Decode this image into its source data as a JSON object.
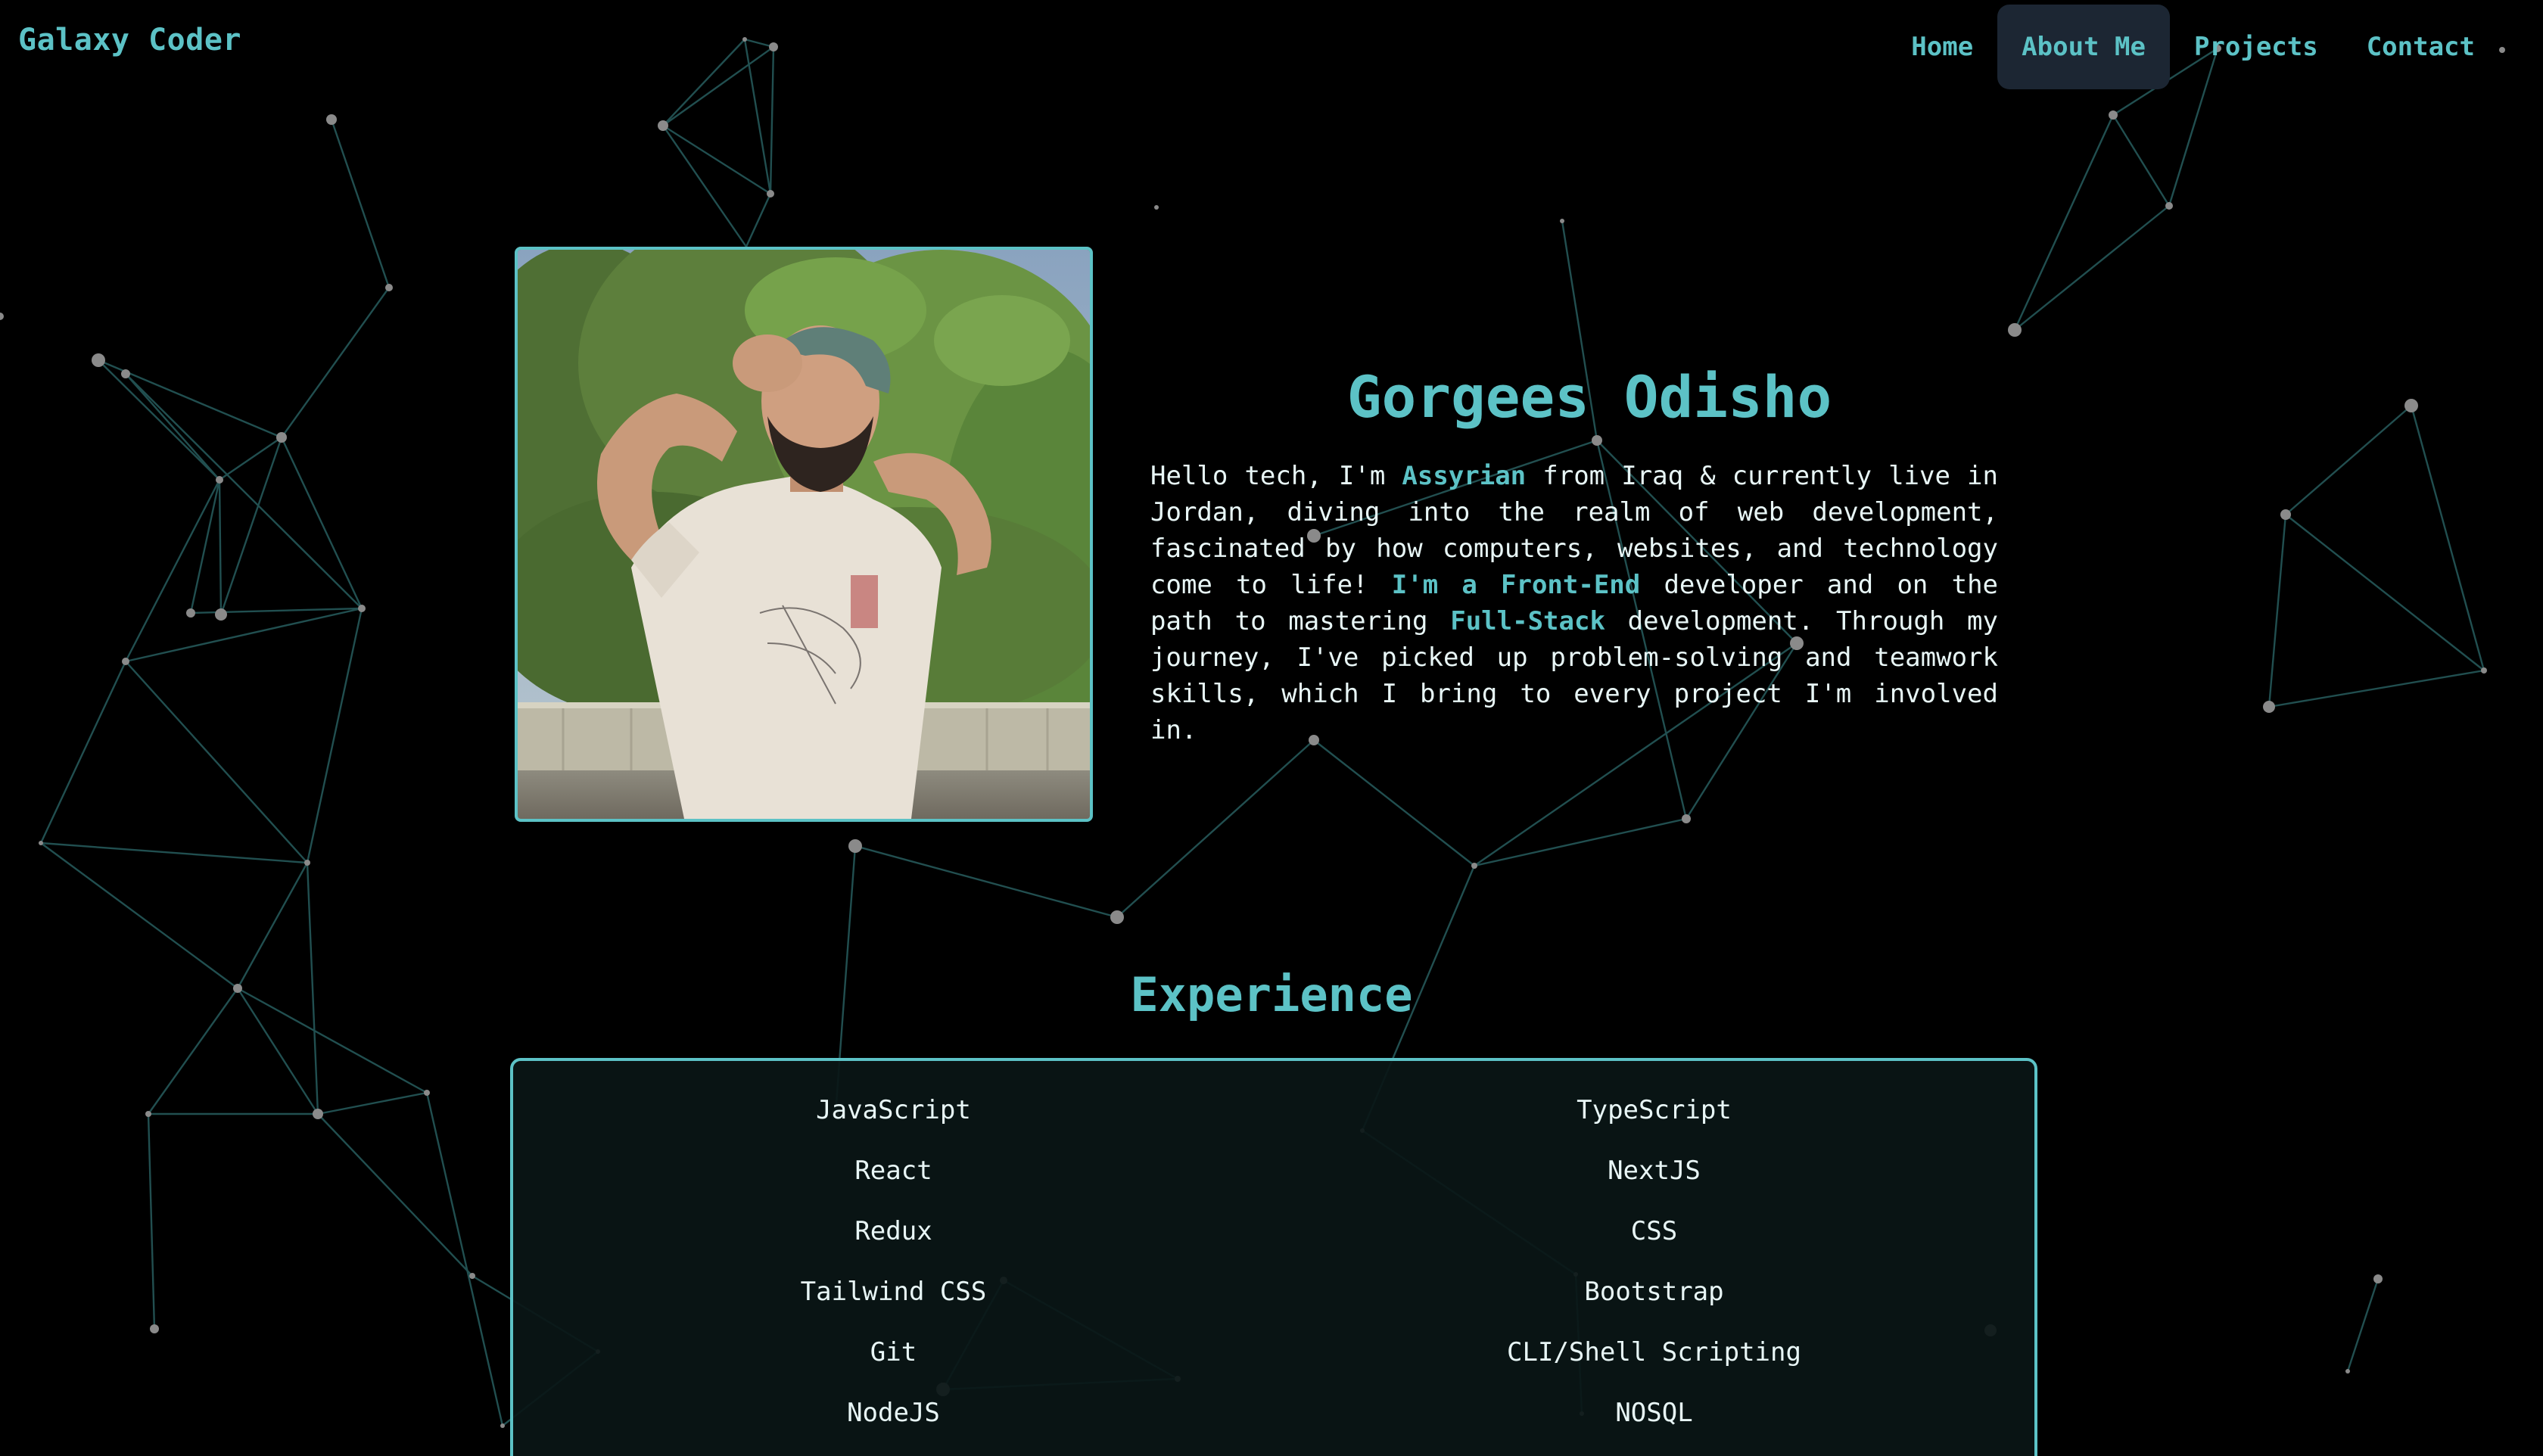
{
  "navbar": {
    "brand": "Galaxy Coder",
    "links": [
      {
        "label": "Home",
        "active": false
      },
      {
        "label": "About Me",
        "active": true
      },
      {
        "label": "Projects",
        "active": false
      },
      {
        "label": "Contact",
        "active": false
      }
    ]
  },
  "about": {
    "photo_alt": "Portrait of Gorgees Odisho",
    "name": "Gorgees Odisho",
    "bio": {
      "p1": "Hello tech, I'm ",
      "hl1": "Assyrian",
      "p2": " from Iraq & currently live in Jordan, diving into the realm of web development, fascinated by how computers, websites, and technology come to life! ",
      "hl2": "I'm a Front-End",
      "p3": " developer and on the path to mastering ",
      "hl3": "Full-Stack",
      "p4": " development. Through my journey, I've picked up problem-solving and teamwork skills, which I bring to every project I'm involved in."
    }
  },
  "experience": {
    "title": "Experience",
    "left": [
      "JavaScript",
      "React",
      "Redux",
      "Tailwind CSS",
      "Git",
      "NodeJS"
    ],
    "right": [
      "TypeScript",
      "NextJS",
      "CSS",
      "Bootstrap",
      "CLI/Shell Scripting",
      "NOSQL"
    ]
  },
  "colors": {
    "accent": "#5cc2c6",
    "background": "#000000",
    "nav_active_bg": "#1c2633",
    "text": "#e8f6f6"
  }
}
